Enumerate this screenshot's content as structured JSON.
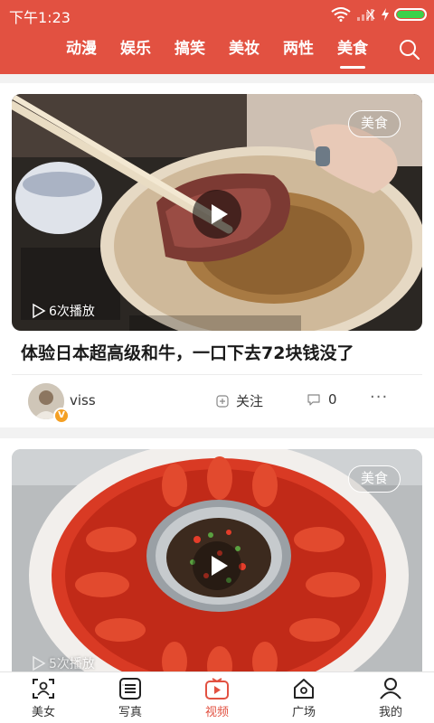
{
  "status_bar": {
    "time": "下午1:23"
  },
  "category_tabs": [
    {
      "label": "动漫",
      "active": false
    },
    {
      "label": "娱乐",
      "active": false
    },
    {
      "label": "搞笑",
      "active": false
    },
    {
      "label": "美妆",
      "active": false
    },
    {
      "label": "两性",
      "active": false
    },
    {
      "label": "美食",
      "active": true
    }
  ],
  "icons": {
    "search": "search-icon",
    "play": "play-icon",
    "follow": "plus-icon",
    "comment": "comment-icon",
    "more": "more-icon"
  },
  "colors": {
    "brand": "#e25141",
    "battery": "#3bd24b",
    "badge": "#f4a024"
  },
  "feed": [
    {
      "tag": "美食",
      "play_count": "6次播放",
      "title": "体验日本超高级和牛，一口下去72块钱没了",
      "author": "viss",
      "follow_label": "关注",
      "comment_count": "0",
      "more": "···"
    },
    {
      "tag": "美食",
      "play_count": "5次播放"
    }
  ],
  "bottom_nav": [
    {
      "label": "美女",
      "icon": "scan-icon",
      "active": false
    },
    {
      "label": "写真",
      "icon": "list-icon",
      "active": false
    },
    {
      "label": "视频",
      "icon": "video-icon",
      "active": true
    },
    {
      "label": "广场",
      "icon": "home-icon",
      "active": false
    },
    {
      "label": "我的",
      "icon": "profile-icon",
      "active": false
    }
  ]
}
